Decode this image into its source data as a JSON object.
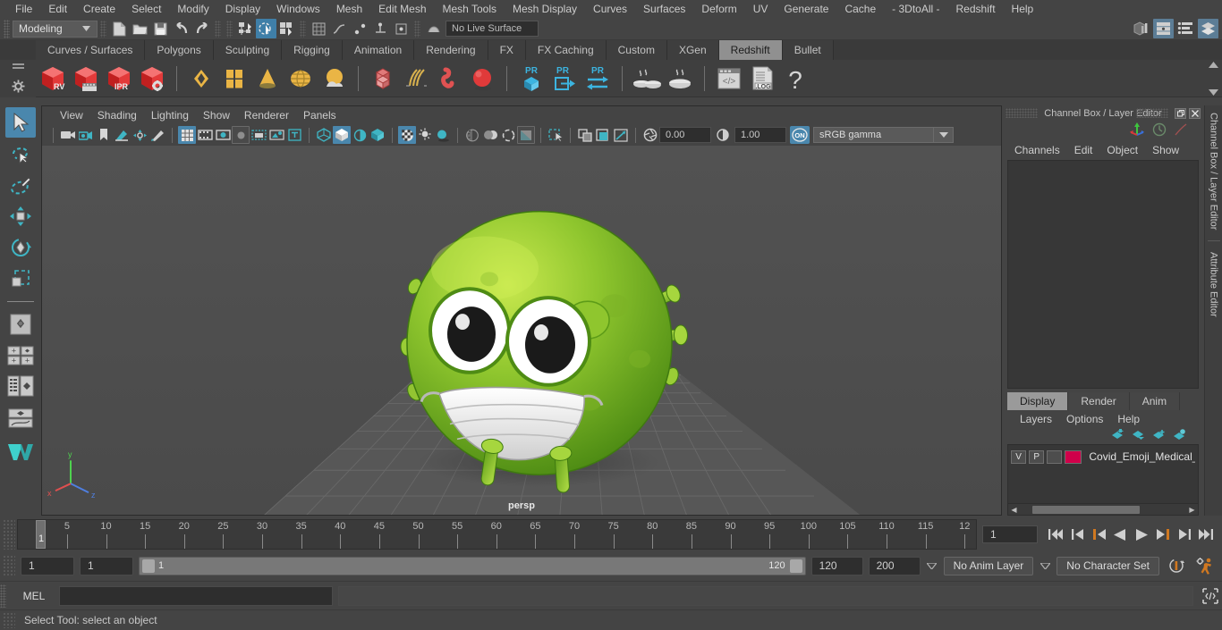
{
  "menubar": {
    "items": [
      "File",
      "Edit",
      "Create",
      "Select",
      "Modify",
      "Display",
      "Windows",
      "Mesh",
      "Edit Mesh",
      "Mesh Tools",
      "Mesh Display",
      "Curves",
      "Surfaces",
      "Deform",
      "UV",
      "Generate",
      "Cache",
      "- 3DtoAll -",
      "Redshift",
      "Help"
    ]
  },
  "statusline": {
    "mode": "Modeling",
    "live_surface": "No Live Surface",
    "icons": [
      "new-scene-icon",
      "open-scene-icon",
      "save-scene-icon",
      "undo-icon",
      "redo-icon",
      "select-by-hierarchy-icon",
      "select-by-object-icon",
      "select-by-component-icon"
    ]
  },
  "shelf": {
    "tabs": [
      "Curves / Surfaces",
      "Polygons",
      "Sculpting",
      "Rigging",
      "Animation",
      "Rendering",
      "FX",
      "FX Caching",
      "Custom",
      "XGen",
      "Redshift",
      "Bullet"
    ],
    "selected_tab": "Redshift",
    "icons": [
      "redshift-rv-icon",
      "redshift-render-sequence-icon",
      "redshift-ipr-icon",
      "redshift-render-settings-icon",
      "redshift-area-light-icon",
      "redshift-portal-light-icon",
      "redshift-ies-light-icon",
      "redshift-dome-light-icon",
      "redshift-physical-sun-icon",
      "redshift-proxy-icon",
      "redshift-hair-icon",
      "redshift-volume-icon",
      "redshift-sphere-icon",
      "redshift-pr-bake-icon",
      "redshift-pr-export-icon",
      "redshift-pr-transfer-icon",
      "redshift-bake-icon",
      "redshift-bake-set-icon",
      "redshift-script-icon",
      "redshift-log-icon",
      "redshift-help-icon"
    ]
  },
  "toolbox": {
    "items": [
      "select-tool",
      "lasso-select-tool",
      "paint-select-tool",
      "move-tool",
      "rotate-tool",
      "scale-tool",
      "last-tool-used",
      "single-pane-layout",
      "two-pane-layout",
      "outliner-persp-layout",
      "persp-graph-layout",
      "maya-logo"
    ],
    "selected": "select-tool"
  },
  "viewport": {
    "menus": [
      "View",
      "Shading",
      "Lighting",
      "Show",
      "Renderer",
      "Panels"
    ],
    "exposure_value": "0.00",
    "gamma_value": "1.00",
    "color_management": "sRGB gamma",
    "camera_label": "persp",
    "toolbar_icons": [
      "select-camera-icon",
      "camera-attributes-icon",
      "bookmark-icon",
      "image-plane-icon",
      "two-d-pan-zoom-icon",
      "grease-pencil-icon",
      "grid-toggle-icon",
      "film-gate-icon",
      "resolution-gate-icon",
      "gate-mask-icon",
      "film-origin-icon",
      "exposure-icon",
      "xray-icon",
      "wireframe-shaded-icon",
      "smooth-shade-icon",
      "shaded-textured-icon",
      "use-all-lights-icon",
      "shadows-icon",
      "screen-space-ao-icon",
      "motion-blur-icon",
      "multisample-icon",
      "isolate-select-icon",
      "xray-joints-icon",
      "xray-active-icon",
      "exposure-toggle-icon",
      "view-transform-icon"
    ]
  },
  "channel_box": {
    "title": "Channel Box / Layer Editor",
    "menus": [
      "Channels",
      "Edit",
      "Object",
      "Show"
    ],
    "side_tabs": [
      "Channel Box / Layer Editor",
      "Attribute Editor"
    ],
    "window_buttons": [
      "undock-icon",
      "close-icon"
    ]
  },
  "layer_editor": {
    "tabs": [
      "Display",
      "Render",
      "Anim"
    ],
    "selected_tab": "Display",
    "menus": [
      "Layers",
      "Options",
      "Help"
    ],
    "toolbar_icons": [
      "move-layer-up-icon",
      "move-layer-down-icon",
      "new-layer-icon",
      "new-layer-from-selected-icon"
    ],
    "layers": [
      {
        "visibility": "V",
        "playback": "P",
        "shading": "",
        "color": "#d0004a",
        "name": "Covid_Emoji_Medical_I"
      }
    ]
  },
  "time_slider": {
    "tick_labels": [
      "5",
      "10",
      "15",
      "20",
      "25",
      "30",
      "35",
      "40",
      "45",
      "50",
      "55",
      "60",
      "65",
      "70",
      "75",
      "80",
      "85",
      "90",
      "95",
      "100",
      "105",
      "110",
      "115",
      "12"
    ],
    "current_frame_marker": "1",
    "current_frame_field": "1",
    "playback_buttons": [
      "go-to-start-icon",
      "step-back-keyframe-icon",
      "step-back-frame-icon",
      "play-backwards-icon",
      "play-forwards-icon",
      "step-forward-frame-icon",
      "step-forward-keyframe-icon",
      "go-to-end-icon"
    ]
  },
  "range_slider": {
    "anim_start": "1",
    "playback_start": "1",
    "range_label_left": "1",
    "range_label_right": "120",
    "playback_end": "120",
    "anim_end": "200",
    "anim_layer": "No Anim Layer",
    "character_set": "No Character Set",
    "icons": [
      "auto-keyframe-icon",
      "animation-preferences-icon"
    ]
  },
  "command_line": {
    "label": "MEL",
    "input_value": "",
    "output_value": "",
    "icon": "script-editor-icon"
  },
  "help_line": {
    "text": "Select Tool: select an object"
  },
  "colors": {
    "accent_blue": "#4a87ad",
    "shelf_selected": "#909090",
    "layer_color": "#d0004a",
    "orange": "#d07820",
    "bg": "#444444",
    "viewport_bg": "#4d4d4d"
  }
}
